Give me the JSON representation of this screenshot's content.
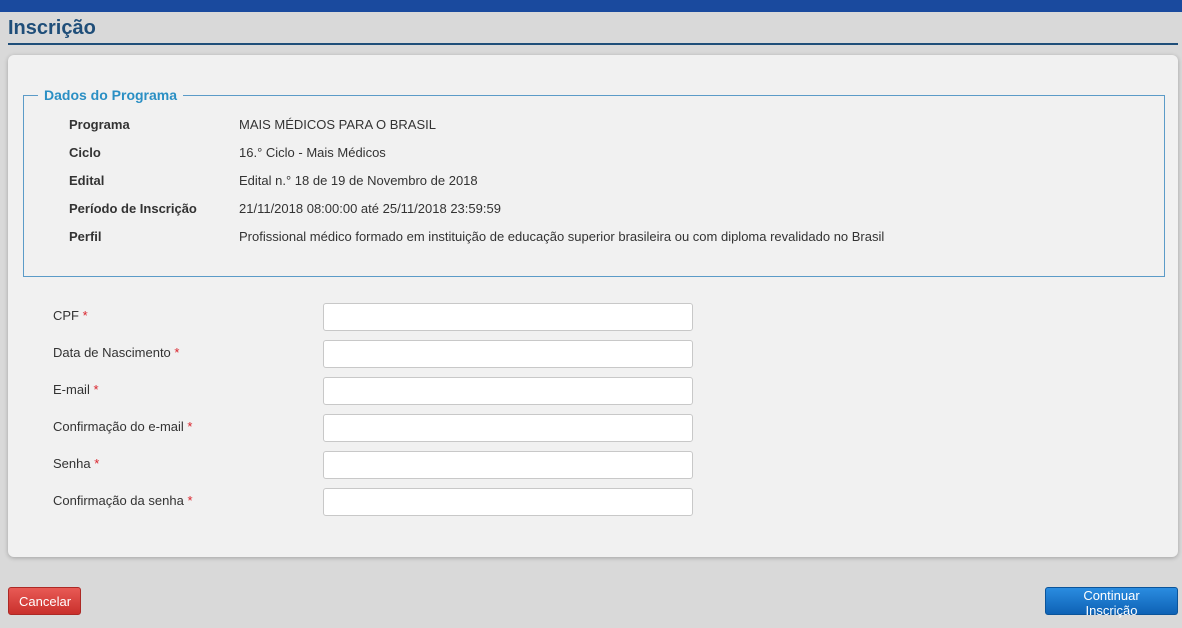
{
  "header": {
    "title": "Inscrição"
  },
  "program": {
    "legend": "Dados do Programa",
    "rows": [
      {
        "label": "Programa",
        "value": "MAIS MÉDICOS PARA O BRASIL"
      },
      {
        "label": "Ciclo",
        "value": "16.° Ciclo - Mais Médicos"
      },
      {
        "label": "Edital",
        "value": "Edital n.° 18 de 19 de Novembro de 2018"
      },
      {
        "label": "Período de Inscrição",
        "value": "21/11/2018 08:00:00 até 25/11/2018 23:59:59"
      },
      {
        "label": "Perfil",
        "value": "Profissional médico formado em instituição de educação superior brasileira ou com diploma revalidado no Brasil"
      }
    ]
  },
  "form": {
    "required_mark": "*",
    "fields": [
      {
        "label": "CPF",
        "value": ""
      },
      {
        "label": "Data de Nascimento",
        "value": ""
      },
      {
        "label": "E-mail",
        "value": ""
      },
      {
        "label": "Confirmação do e-mail",
        "value": ""
      },
      {
        "label": "Senha",
        "value": ""
      },
      {
        "label": "Confirmação da senha",
        "value": ""
      }
    ]
  },
  "actions": {
    "cancel_label": "Cancelar",
    "continue_label": "Continuar Inscrição"
  },
  "colors": {
    "topbar": "#1a4a9e",
    "title": "#1f4e79",
    "legend": "#2a8fc4",
    "cancel": "#d9534f",
    "continue": "#1a73c9"
  }
}
